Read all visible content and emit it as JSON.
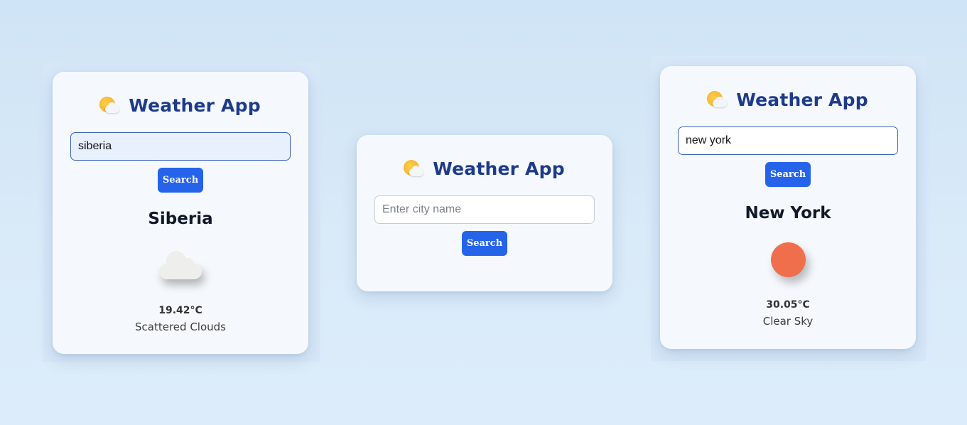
{
  "app": {
    "title": "Weather App",
    "logo_icon": "sun-behind-cloud-icon",
    "accent_color": "#2563eb",
    "title_color": "#1e3a8a"
  },
  "panels": [
    {
      "search": {
        "value": "siberia",
        "placeholder": "Enter city name",
        "button_label": "Search"
      },
      "result": {
        "city": "Siberia",
        "temperature": "19.42°C",
        "description": "Scattered Clouds",
        "icon": "cloud-icon"
      }
    },
    {
      "search": {
        "value": "",
        "placeholder": "Enter city name",
        "button_label": "Search"
      }
    },
    {
      "search": {
        "value": "new york",
        "placeholder": "Enter city name",
        "button_label": "Search"
      },
      "result": {
        "city": "New York",
        "temperature": "30.05°C",
        "description": "Clear Sky",
        "icon": "sun-icon",
        "icon_color": "#ef6f4d"
      }
    }
  ]
}
